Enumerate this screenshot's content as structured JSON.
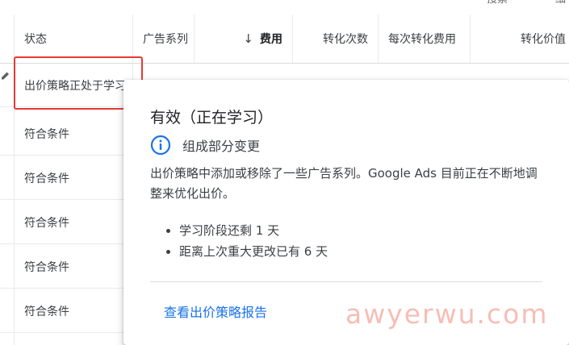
{
  "top_clip": [
    "搜索",
    "细"
  ],
  "columns": [
    {
      "label": "状态"
    },
    {
      "label": "广告系列"
    },
    {
      "label": "费用",
      "sort_arrow": "↓"
    },
    {
      "label": "转化次数"
    },
    {
      "label": "每次转化费用"
    },
    {
      "label": "转化价值"
    }
  ],
  "rows": [
    {
      "status": "出价策略正处于学习"
    },
    {
      "status": "符合条件"
    },
    {
      "status": "符合条件"
    },
    {
      "status": "符合条件"
    },
    {
      "status": "符合条件"
    },
    {
      "status": "符合条件"
    }
  ],
  "popup": {
    "title": "有效（正在学习）",
    "info_label": "组成部分变更",
    "description": "出价策略中添加或移除了一些广告系列。Google Ads 目前正在不断地调整来优化出价。",
    "bullets": [
      "学习阶段还剩 1 天",
      "距离上次重大更改已有 6 天"
    ],
    "link": "查看出价策略报告"
  },
  "watermark": "awyerwu.com",
  "colors": {
    "highlight": "#e53935",
    "link": "#1a73e8",
    "info_icon": "#1a73e8",
    "watermark": "#f5b3a8"
  }
}
